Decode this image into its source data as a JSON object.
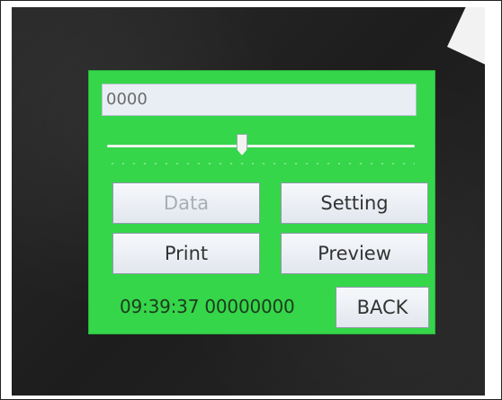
{
  "screen": {
    "text_field_value": "0000",
    "slider_level": 0.44,
    "buttons": {
      "data": "Data",
      "setting": "Setting",
      "print": "Print",
      "preview": "Preview",
      "back": "BACK"
    },
    "status_text": "09:39:37 00000000"
  },
  "colors": {
    "screen_background": "#35d64a",
    "button_background": "#e9eef5",
    "disabled_text": "#a7aeb8"
  }
}
